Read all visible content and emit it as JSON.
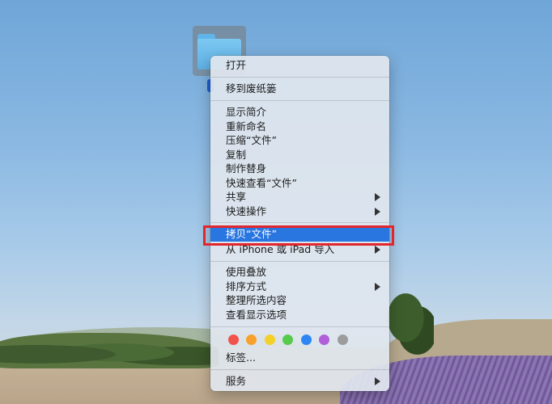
{
  "menu": {
    "items": {
      "open": "打开",
      "trash": "移到废纸篓",
      "get_info": "显示简介",
      "rename": "重新命名",
      "compress": "压缩“文件”",
      "duplicate": "复制",
      "make_alias": "制作替身",
      "quick_look": "快速查看“文件”",
      "share": "共享",
      "quick_actions": "快速操作",
      "copy": "拷贝“文件”",
      "from_iphone": "从 iPhone 或 iPad 导入",
      "use_stacks": "使用叠放",
      "sort_by": "排序方式",
      "clean_up": "整理所选内容",
      "view_options": "查看显示选项",
      "tags": "标签...",
      "services": "服务"
    },
    "tag_colors": [
      "#f0524c",
      "#f7a12c",
      "#f4d02a",
      "#57c94b",
      "#2d86f3",
      "#b15fd8",
      "#9c9c9c"
    ],
    "highlight_color": "#2a76e0",
    "annotation_box_color": "#e3262c"
  },
  "icons": {
    "folder": "folder-icon",
    "submenu": "chevron-right-icon"
  }
}
